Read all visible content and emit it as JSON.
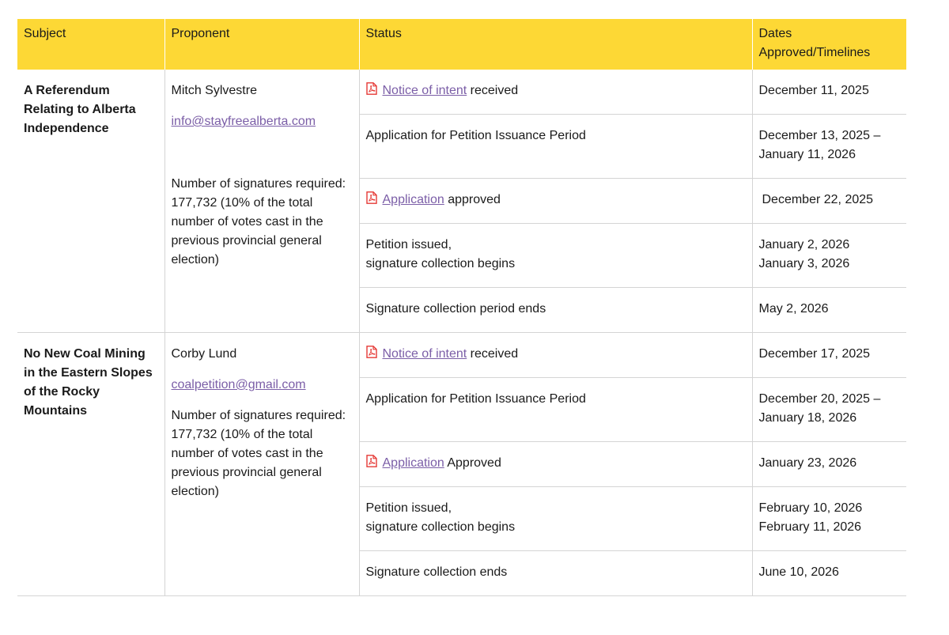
{
  "headers": {
    "subject": "Subject",
    "proponent": "Proponent",
    "status": "Status",
    "dates_line1": "Dates",
    "dates_line2": "Approved/Timelines"
  },
  "petitions": [
    {
      "subject": "A Referendum Relating to Alberta Independence",
      "proponent_name": "Mitch Sylvestre",
      "proponent_email": "info@stayfreealberta.com",
      "signatures_note": "Number of signatures required: 177,732 (10% of the total number of votes cast in the previous provincial general election)",
      "steps": [
        {
          "link": "Notice of intent",
          "text": " received",
          "date1": "December 11, 2025"
        },
        {
          "text": "Application for Petition Issuance Period",
          "date1": "December 13, 2025 –",
          "date2": "January 11, 2026"
        },
        {
          "link": "Application",
          "text": " approved",
          "date1": "December 22, 2025"
        },
        {
          "text": "Petition issued,",
          "text2": "signature collection begins",
          "date1": "January 2, 2026",
          "date2": "January 3, 2026"
        },
        {
          "text": "Signature collection period ends",
          "date1": "May 2, 2026"
        }
      ]
    },
    {
      "subject": "No New Coal Mining in the Eastern Slopes of the Rocky Mountains",
      "proponent_name": "Corby Lund",
      "proponent_email": "coalpetition@gmail.com",
      "signatures_note": "Number of signatures required: 177,732 (10% of the total number of votes cast in the previous provincial general election)",
      "steps": [
        {
          "link": "Notice of intent",
          "text": " received",
          "date1": "December 17, 2025"
        },
        {
          "text": "Application for Petition Issuance Period",
          "date1": "December 20, 2025 –",
          "date2": "January 18, 2026"
        },
        {
          "link": "Application",
          "text": " Approved",
          "date1": "January 23, 2026"
        },
        {
          "text": "Petition issued,",
          "text2": "signature collection begins",
          "date1": "February 10, 2026",
          "date2": "February 11, 2026"
        },
        {
          "text": "Signature collection ends",
          "date1": "June 10, 2026"
        }
      ]
    }
  ],
  "icons": {
    "document": "pdf-icon"
  },
  "colors": {
    "header_bg": "#fdd835",
    "link": "#7b5ea7",
    "pdf_icon": "#e53935",
    "border": "#d4d4d4"
  }
}
